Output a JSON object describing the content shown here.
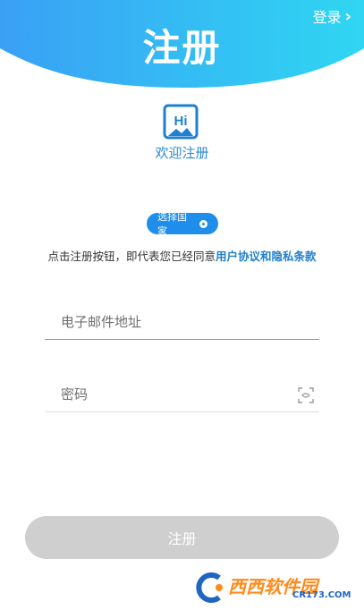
{
  "header": {
    "title": "注册",
    "login_label": "登录"
  },
  "logo": {
    "text": "Hi"
  },
  "welcome_text": "欢迎注册",
  "country_button_label": "选择国家",
  "agreement": {
    "prefix": "点击注册按钮，即代表您已经同意",
    "link": "用户协议和隐私条款"
  },
  "form": {
    "email_placeholder": "电子邮件地址",
    "password_placeholder": "密码"
  },
  "register_button_label": "注册",
  "watermark": {
    "text": "西西软件园",
    "sub": "CR173.COM"
  },
  "colors": {
    "header_gradient_start": "#3aa0f5",
    "header_gradient_end": "#2fd6f2",
    "accent": "#1f8eea",
    "button_disabled": "#cfcfcf"
  }
}
